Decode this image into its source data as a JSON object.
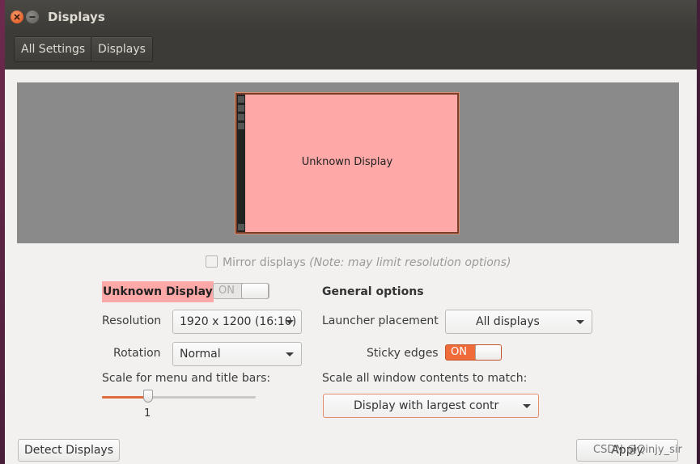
{
  "window": {
    "title": "Displays"
  },
  "toolbar": {
    "all_settings": "All Settings",
    "displays": "Displays"
  },
  "preview": {
    "monitor_label": "Unknown Display"
  },
  "mirror": {
    "label": "Mirror displays",
    "note": "(Note: may limit resolution options)",
    "checked": false
  },
  "display": {
    "name": "Unknown Display",
    "power_toggle": "ON",
    "resolution_label": "Resolution",
    "resolution_value": "1920 x 1200 (16:10)",
    "rotation_label": "Rotation",
    "rotation_value": "Normal",
    "scale_label": "Scale for menu and title bars:",
    "scale_value": "1",
    "scale_fraction": 0.3
  },
  "general": {
    "heading": "General options",
    "launcher_label": "Launcher placement",
    "launcher_value": "All displays",
    "sticky_label": "Sticky edges",
    "sticky_toggle": "ON",
    "scale_all_label": "Scale all window contents to match:",
    "scale_all_value": "Display with largest contr"
  },
  "buttons": {
    "detect": "Detect Displays",
    "apply": "Apply"
  },
  "watermark": "CSDN @Qinjy_sir",
  "colors": {
    "accent": "#ef6b3a",
    "monitor": "#ffa8a8",
    "titlebar": "#3c3b37"
  },
  "icons": {
    "close": "close-icon",
    "minimize": "minimize-icon"
  }
}
